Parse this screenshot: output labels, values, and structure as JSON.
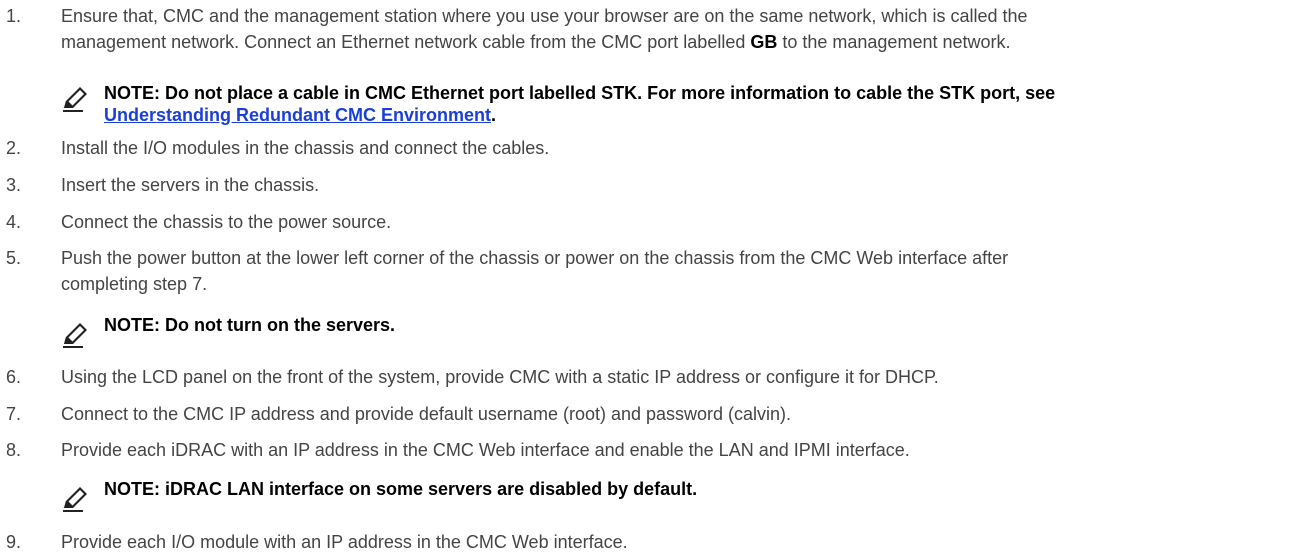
{
  "steps": [
    {
      "num": "1.",
      "line1": "Ensure that, CMC and the management station where you use your browser are on the same network, which is called the",
      "line2_pre": "management network. Connect an Ethernet network cable from the CMC port labelled ",
      "line2_bold": "GB",
      "line2_post": " to the management network."
    },
    {
      "num": "2.",
      "text": "Install the I/O modules in the chassis and connect the cables."
    },
    {
      "num": "3.",
      "text": "Insert the servers in the chassis."
    },
    {
      "num": "4.",
      "text": "Connect the chassis to the power source."
    },
    {
      "num": "5.",
      "line1": "Push the power button at the lower left corner of the chassis or power on the chassis from the CMC Web interface after",
      "line2": "completing step 7."
    },
    {
      "num": "6.",
      "text": "Using the LCD panel on the front of the system, provide CMC with a static IP address or configure it for DHCP."
    },
    {
      "num": "7.",
      "text": "Connect to the CMC IP address and provide default username (root) and password (calvin)."
    },
    {
      "num": "8.",
      "text": "Provide each iDRAC with an IP address in the CMC Web interface and enable the LAN and IPMI interface."
    },
    {
      "num": "9.",
      "text": "Provide each I/O module with an IP address in the CMC Web interface."
    }
  ],
  "notes": {
    "stk": {
      "line1": "NOTE: Do not place a cable in CMC Ethernet port labelled STK. For more information to cable the STK port, see",
      "link": "Understanding Redundant CMC Environment",
      "after_link": "."
    },
    "servers": {
      "text": "NOTE: Do not turn on the servers."
    },
    "idrac": {
      "text": "NOTE: iDRAC LAN interface on some servers are disabled by default."
    }
  },
  "icon": {
    "name": "note-pencil-icon"
  },
  "colors": {
    "link": "#1a3fd9",
    "body_text": "#444444",
    "note_text": "#000000"
  }
}
